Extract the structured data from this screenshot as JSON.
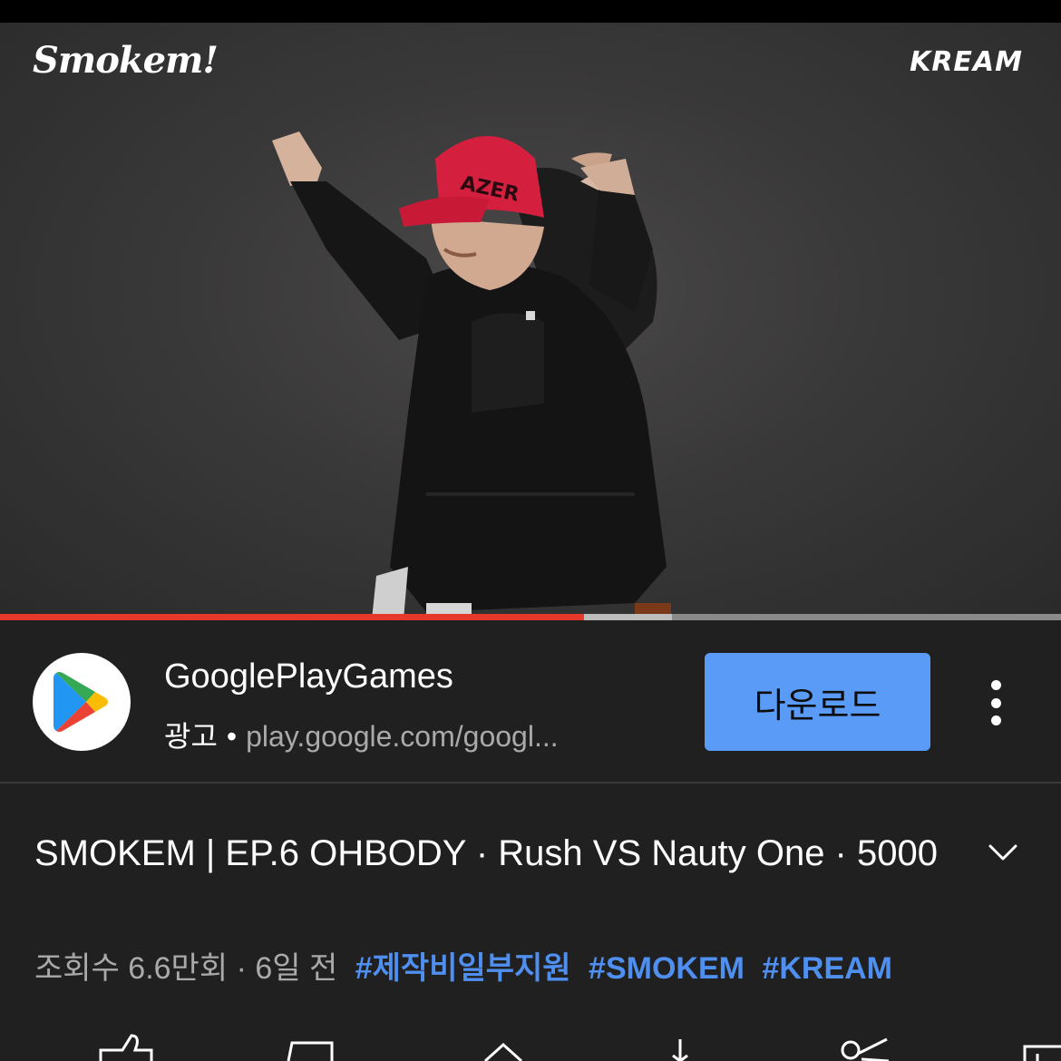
{
  "player": {
    "logo_left": "Smokem!",
    "logo_right": "KREAM",
    "progress_played": 0.55,
    "progress_buffered": 0.633
  },
  "ad": {
    "advertiser": "GooglePlayGames",
    "tag": "광고",
    "url": "play.google.com/googl...",
    "cta": "다운로드"
  },
  "video": {
    "title": "SMOKEM | EP.6 OHBODY · Rush VS Nauty One · 5000",
    "views": "조회수 6.6만회",
    "age": "6일 전",
    "hashtags": [
      "#제작비일부지원",
      "#SMOKEM",
      "#KREAM"
    ]
  },
  "colors": {
    "background": "#202020",
    "accent_red": "#e7392b",
    "cta_blue": "#5a9bf7",
    "hashtag_blue": "#4f8ff0"
  },
  "icons": [
    "like-icon",
    "save-icon",
    "share-icon",
    "download-icon",
    "clip-icon",
    "remix-icon"
  ]
}
